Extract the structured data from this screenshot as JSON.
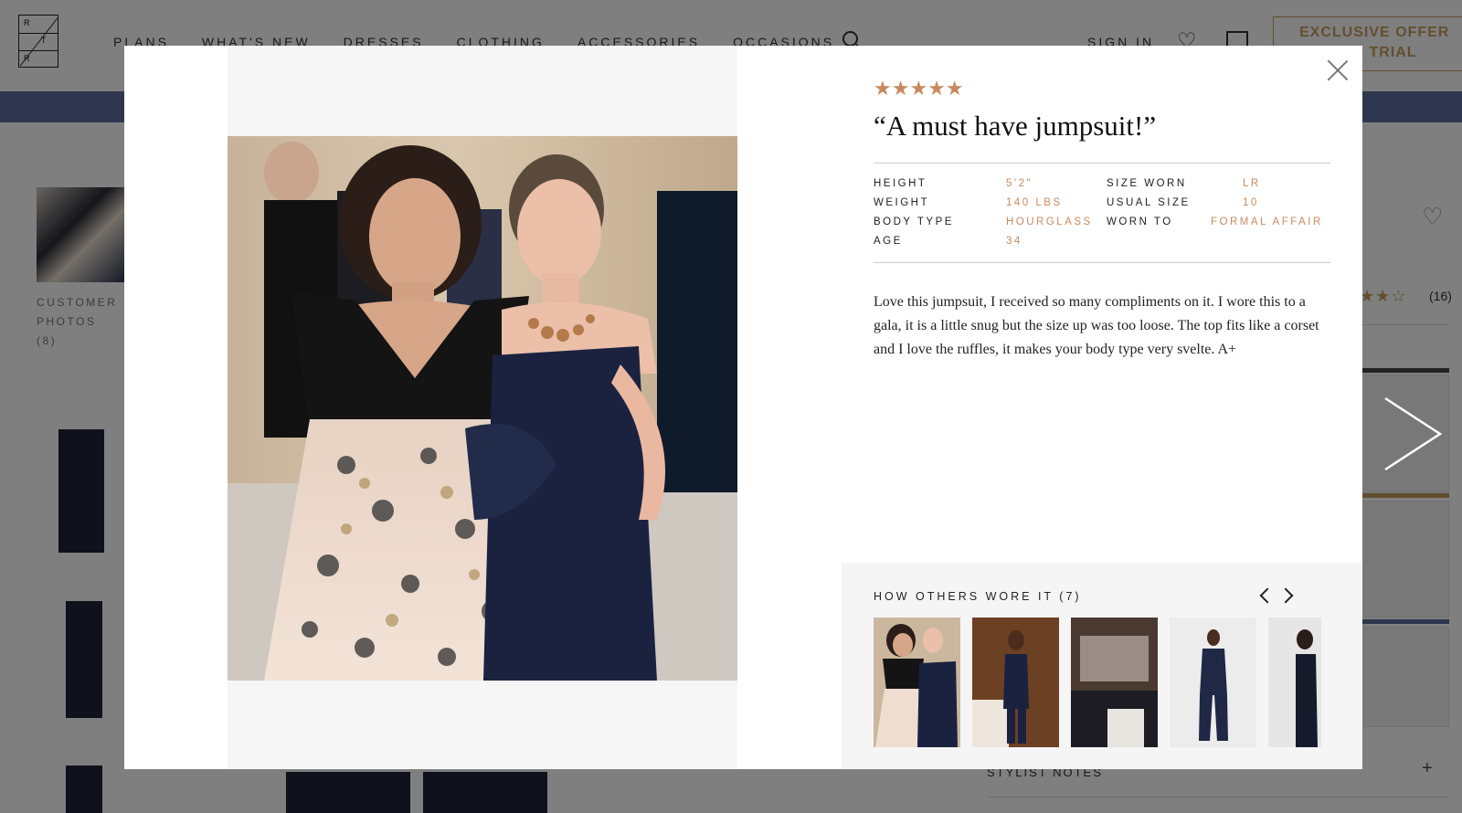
{
  "nav": {
    "logo_letters": [
      "R",
      "T",
      "R"
    ],
    "items": [
      "PLANS",
      "WHAT'S NEW",
      "DRESSES",
      "CLOTHING",
      "ACCESSORIES",
      "OCCASIONS"
    ],
    "sign_in": "SIGN IN",
    "offer_line1": "EXCLUSIVE OFFER",
    "offer_line2": "LIMITED TRIAL"
  },
  "sidebar": {
    "customer_photos_label": "CUSTOMER",
    "customer_photos_label2": "PHOTOS",
    "customer_photos_count": "(8)"
  },
  "product": {
    "review_count": "(16)",
    "stylist_notes": "STYLIST NOTES"
  },
  "review": {
    "rating": 5,
    "stars": "★★★★★",
    "title": "“A must have jumpsuit!”",
    "stats": {
      "height_label": "HEIGHT",
      "height": "5'2\"",
      "weight_label": "WEIGHT",
      "weight": "140 LBS",
      "body_type_label": "BODY TYPE",
      "body_type": "HOURGLASS",
      "age_label": "AGE",
      "age": "34",
      "size_worn_label": "SIZE WORN",
      "size_worn": "LR",
      "usual_size_label": "USUAL SIZE",
      "usual_size": "10",
      "worn_to_label": "WORN TO",
      "worn_to": "FORMAL AFFAIR"
    },
    "body": "Love this jumpsuit, I received so many compliments on it. I wore this to a gala, it is a little snug but the size up was too loose. The top fits like a corset and I love the ruffles, it makes your body type very svelte. A+"
  },
  "others": {
    "title": "HOW OTHERS WORE IT (7)"
  },
  "colors": {
    "accent_gold": "#c88a5e",
    "promo_blue": "#5c6f9e",
    "navy_dress": "#1f2538"
  }
}
